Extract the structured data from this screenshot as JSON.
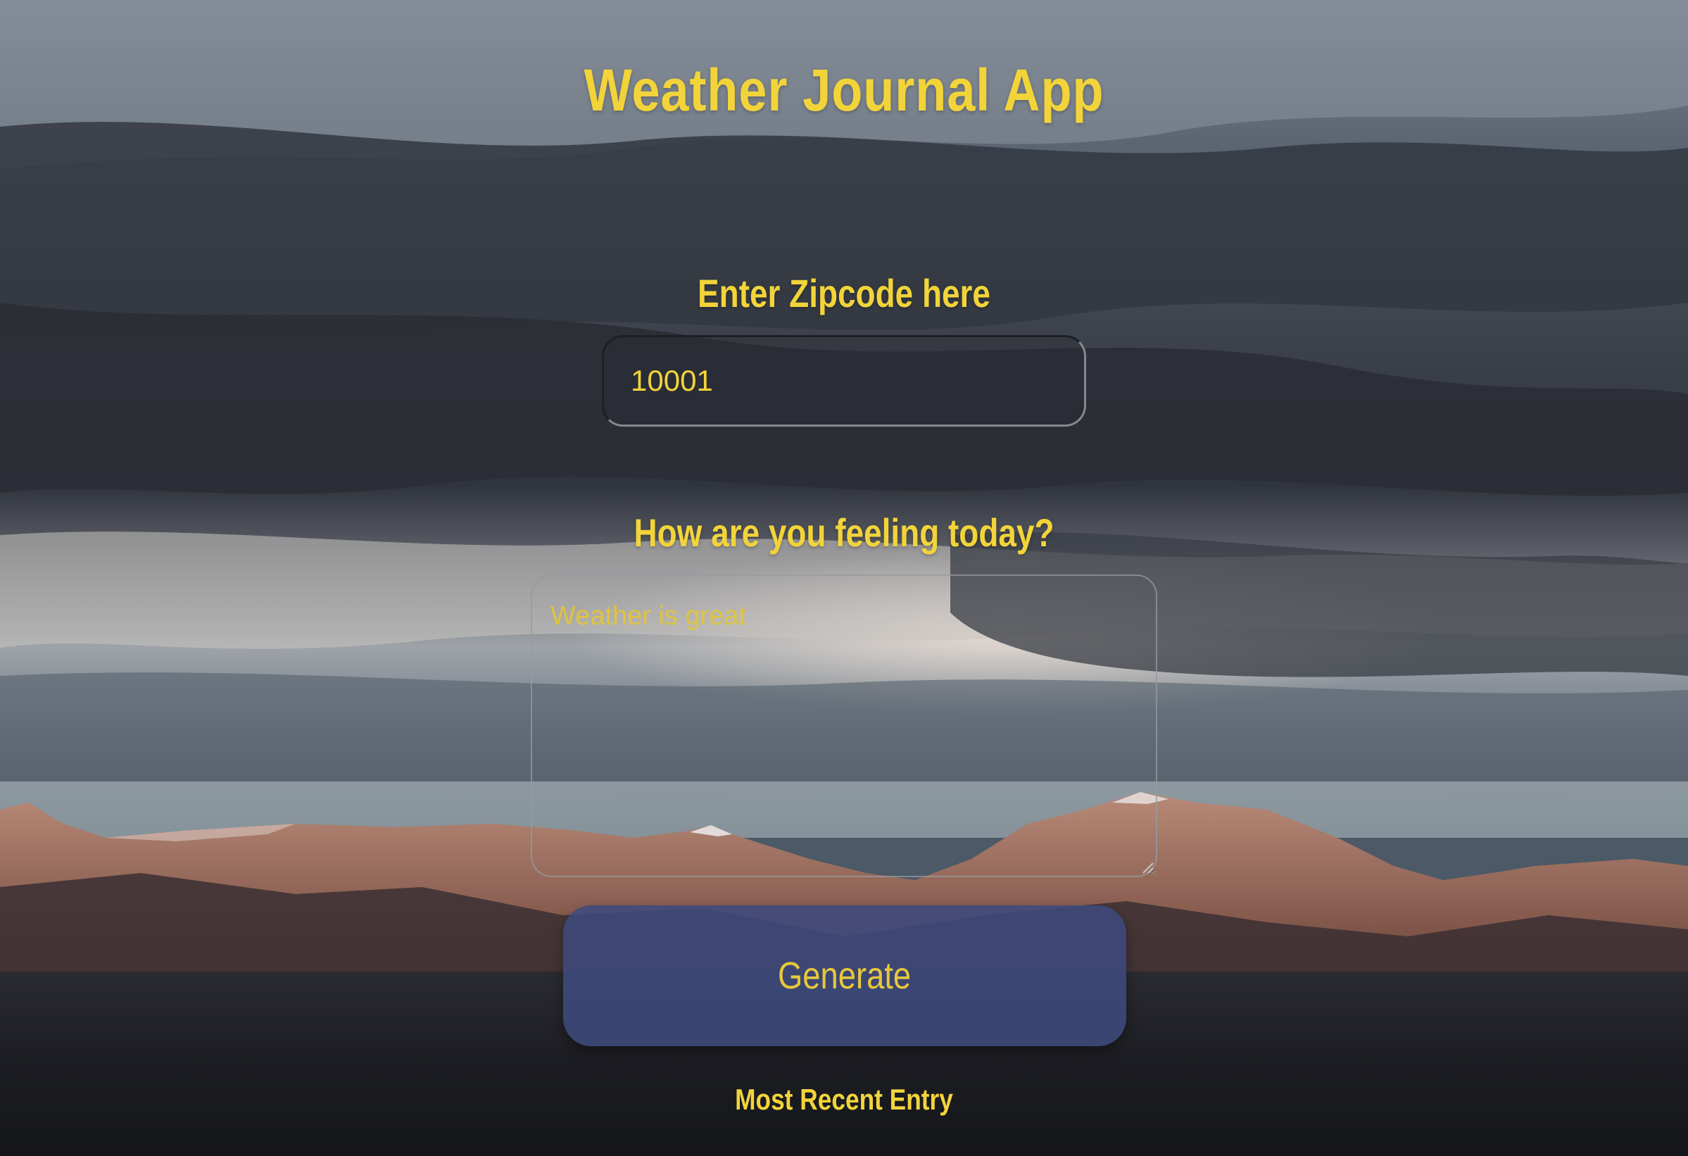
{
  "app": {
    "title": "Weather Journal App"
  },
  "zipcode": {
    "label": "Enter Zipcode here",
    "value": "10001"
  },
  "feelings": {
    "label": "How are you feeling today?",
    "placeholder": "Weather is great"
  },
  "generate": {
    "label": "Generate"
  },
  "recent": {
    "title": "Most Recent Entry"
  },
  "colors": {
    "accent_text": "#f2d43a",
    "button_bg": "#3e4a7d",
    "sky_dark": "#2c3038",
    "mountain_rock": "#8a5a4a"
  }
}
